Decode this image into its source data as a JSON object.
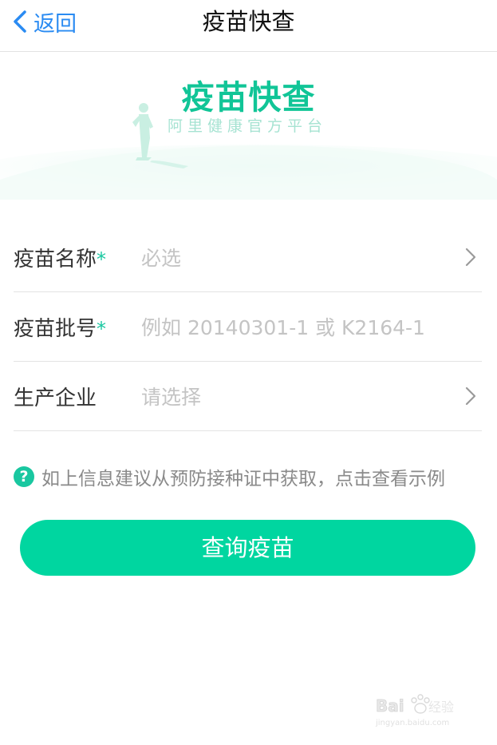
{
  "nav": {
    "back_label": "返回",
    "title": "疫苗快查"
  },
  "hero": {
    "title": "疫苗快查",
    "subtitle": "阿里健康官方平台",
    "brand_color": "#11c597"
  },
  "form": {
    "rows": [
      {
        "label": "疫苗名称",
        "required_mark": "*",
        "placeholder": "必选",
        "has_chevron": true
      },
      {
        "label": "疫苗批号",
        "required_mark": "*",
        "placeholder": "例如 20140301-1 或 K2164-1",
        "has_chevron": false
      },
      {
        "label": "生产企业",
        "required_mark": "",
        "placeholder": "请选择",
        "has_chevron": true
      }
    ]
  },
  "hint": {
    "icon": "?",
    "text": "如上信息建议从预防接种证中获取，点击查看示例"
  },
  "query_button": {
    "label": "查询疫苗",
    "color": "#00d6a0"
  },
  "watermark": {
    "brand": "Bai du 经验",
    "url": "jingyan.baidu.com"
  },
  "colors": {
    "accent": "#19c7a0",
    "link": "#2a8bf2",
    "placeholder": "#c4c4c4",
    "divider": "#e3e3e3"
  }
}
